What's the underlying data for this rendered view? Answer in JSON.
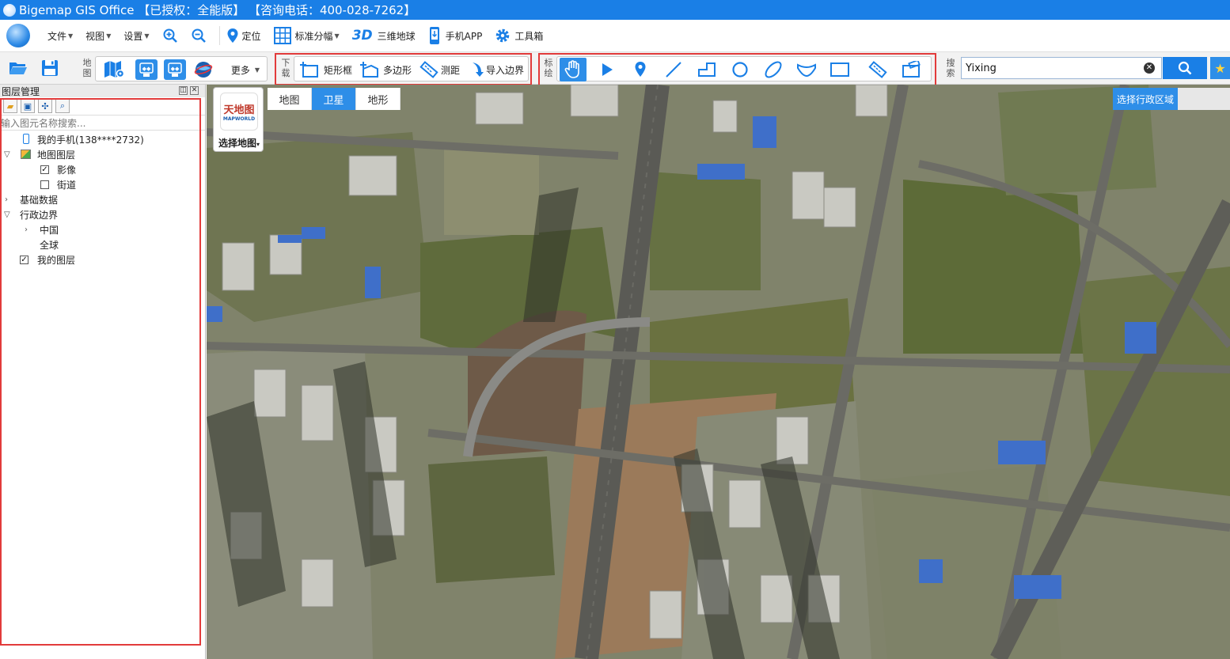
{
  "app": {
    "title": "Bigemap GIS Office 【已授权：全能版】 【咨询电话：400-028-7262】"
  },
  "menubar": {
    "items": [
      {
        "label": "文件",
        "has_caret": true
      },
      {
        "label": "视图",
        "has_caret": true
      },
      {
        "label": "设置",
        "has_caret": true
      }
    ],
    "locate_label": "定位",
    "grid_label": "标准分幅",
    "globe3d_prefix": "3D",
    "globe3d_label": "三维地球",
    "mobile_label": "手机APP",
    "toolbox_label": "工具箱"
  },
  "toolbar": {
    "map_group_label": "地图",
    "more_label": "更多",
    "download_group_label": "下载",
    "rect_label": "矩形框",
    "polygon_label": "多边形",
    "measure_label": "测距",
    "import_boundary_label": "导入边界",
    "draw_group_label": "标绘",
    "search_group_label": "搜索",
    "draw_tools": [
      "hand-icon",
      "pointer-icon",
      "marker-icon",
      "line-icon",
      "polyline-icon",
      "circle-icon",
      "ellipse-icon",
      "curve-icon",
      "rectangle-icon",
      "ruler-icon",
      "area-measure-icon"
    ]
  },
  "search": {
    "value": "Yixing"
  },
  "layer_panel": {
    "title": "图层管理",
    "search_placeholder": "输入图元名称搜索...",
    "tree": [
      {
        "label": "我的手机(138****2732)",
        "level": 1,
        "icon": "phone-icon"
      },
      {
        "label": "地图图层",
        "level": 0,
        "expanded": true,
        "icon": "layers-icon"
      },
      {
        "label": "影像",
        "level": 2,
        "checked": true
      },
      {
        "label": "街道",
        "level": 2,
        "checked": false
      },
      {
        "label": "基础数据",
        "level": 0,
        "expanded": false
      },
      {
        "label": "行政边界",
        "level": 0,
        "expanded": true
      },
      {
        "label": "中国",
        "level": 1,
        "expanded": false
      },
      {
        "label": "全球",
        "level": 1
      },
      {
        "label": "我的图层",
        "level": 0,
        "checked": true
      }
    ]
  },
  "map": {
    "tabs": [
      "地图",
      "卫星",
      "地形"
    ],
    "active_tab": "卫星",
    "map_selector_label": "选择地图",
    "map_selector_logo_text": "天地图",
    "map_selector_logo_sub": "MAPWORLD",
    "region_button_label": "选择行政区域"
  },
  "colors": {
    "accent": "#1a7fe6",
    "highlight_box": "#e23b3b"
  }
}
